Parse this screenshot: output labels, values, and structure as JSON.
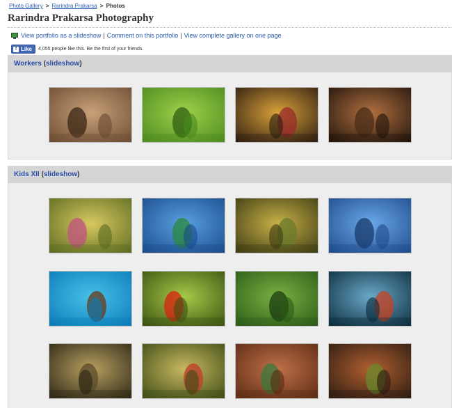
{
  "breadcrumb": {
    "items": [
      "Photo Gallery",
      "Rarindra Prakarsa"
    ],
    "separator": ">",
    "current": "Photos"
  },
  "page": {
    "title": "Rarindra Prakarsa Photography"
  },
  "actions": {
    "slideshow": "View portfolio as a slideshow",
    "comment": "Comment on this portfolio",
    "gallery": "View complete gallery on one page",
    "separator": "|",
    "icon": "monitor-icon"
  },
  "like": {
    "button_label": "Like",
    "icon": "facebook-icon",
    "text": "4,055 people like this. Be the first of your friends."
  },
  "albums": [
    {
      "name": "Workers",
      "slideshow_label": "slideshow",
      "photos": [
        {
          "subject": "woodcarver",
          "colors": [
            "#6b4a30",
            "#c9a27a",
            "#3a2616"
          ]
        },
        {
          "subject": "rice-terrace-farmer",
          "colors": [
            "#4a8a1e",
            "#9fd04a",
            "#2e5d10"
          ]
        },
        {
          "subject": "balinese-dancers",
          "colors": [
            "#2a1a10",
            "#d8a13a",
            "#9a2a2a"
          ]
        },
        {
          "subject": "craftsmen",
          "colors": [
            "#1e120a",
            "#b07040",
            "#4a2c18"
          ]
        }
      ]
    },
    {
      "name": "Kids XII",
      "slideshow_label": "slideshow",
      "photos": [
        {
          "subject": "kids-with-flowers",
          "colors": [
            "#5a6a20",
            "#d8c860",
            "#c05080"
          ]
        },
        {
          "subject": "boy-on-boat",
          "colors": [
            "#1a4a8a",
            "#58a0e0",
            "#2a8a3a"
          ]
        },
        {
          "subject": "kids-on-stilts",
          "colors": [
            "#3a3a12",
            "#c8b048",
            "#6a7a2a"
          ]
        },
        {
          "subject": "kids-swimming",
          "colors": [
            "#1e4a8a",
            "#6aa8e8",
            "#1a3a6a"
          ]
        },
        {
          "subject": "boy-rowing",
          "colors": [
            "#0a7ab8",
            "#48c0e8",
            "#6a3a1a"
          ]
        },
        {
          "subject": "girl-with-flower",
          "colors": [
            "#3a5010",
            "#a8c848",
            "#d82010"
          ]
        },
        {
          "subject": "green-terraces",
          "colors": [
            "#2a5a18",
            "#7ab040",
            "#1a3a10"
          ]
        },
        {
          "subject": "light-rays-forest",
          "colors": [
            "#0a2a3a",
            "#6aa8c8",
            "#c84020"
          ]
        },
        {
          "subject": "bamboo-weaver",
          "colors": [
            "#2a2414",
            "#b8a060",
            "#5a4a28"
          ]
        },
        {
          "subject": "boy-with-bicycle",
          "colors": [
            "#3a4a14",
            "#c8b860",
            "#c03a2a"
          ]
        },
        {
          "subject": "carved-window",
          "colors": [
            "#5a2a14",
            "#c07048",
            "#3a7a3a"
          ]
        },
        {
          "subject": "old-woman-child",
          "colors": [
            "#2a1a10",
            "#b06030",
            "#6a8a2a"
          ]
        }
      ]
    }
  ]
}
